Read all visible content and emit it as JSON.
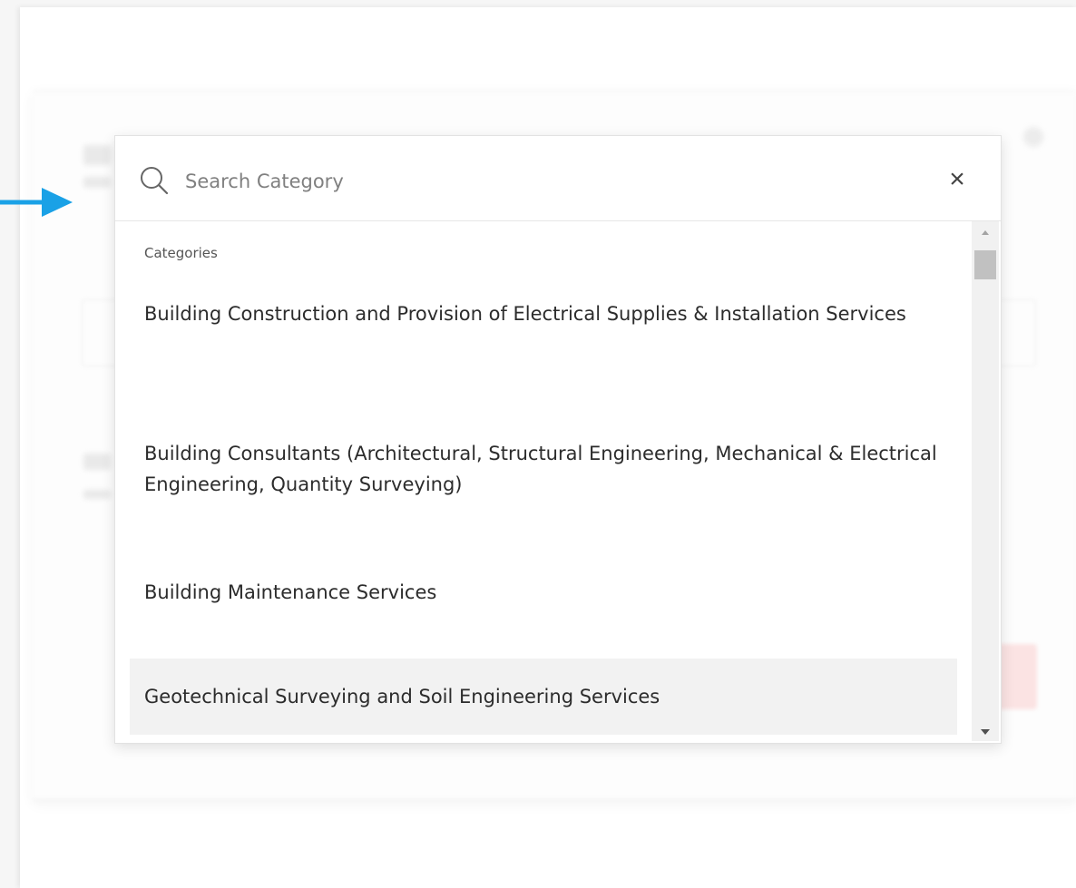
{
  "search": {
    "placeholder": "Search Category",
    "value": ""
  },
  "list": {
    "group_header": "Categories",
    "options": [
      {
        "label": "Building Construction and Provision of Electrical Supplies & Installation Services"
      },
      {
        "label": "Building Consultants (Architectural, Structural Engineering, Mechanical & Electrical Engineering, Quantity Surveying)"
      },
      {
        "label": "Building Maintenance Services"
      },
      {
        "label": "Geotechnical Surveying and Soil Engineering Services",
        "highlighted": true
      }
    ],
    "scroll_position": 0.05
  },
  "icons": {
    "search": "search-icon",
    "close": "close-icon",
    "arrow": "arrow-right-icon",
    "scroll_up": "triangle-up-icon",
    "scroll_down": "triangle-down-icon"
  },
  "colors": {
    "arrow": "#1aa1e6",
    "highlight_bg": "#f2f2f2",
    "scrollbar_track": "#f1f1f1",
    "scrollbar_thumb": "#c1c1c1"
  }
}
